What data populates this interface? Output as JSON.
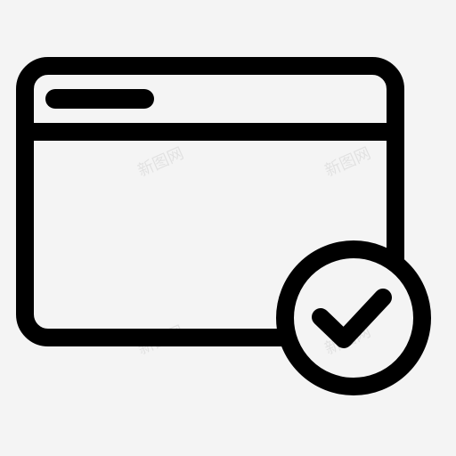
{
  "icon": {
    "name": "browser-window-check-icon",
    "stroke_color": "#000000",
    "fill_color": "#f4f4f4",
    "background_color": "#f4f4f4"
  },
  "watermark": {
    "text": "新图网"
  }
}
